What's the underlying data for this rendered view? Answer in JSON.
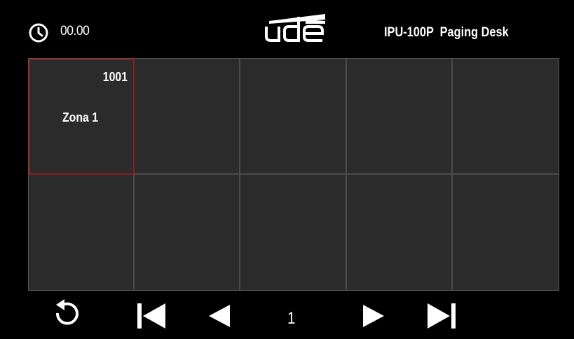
{
  "header": {
    "time": "00.00",
    "logo_text": "ude",
    "device_title": "IPU-100P  Paging Desk"
  },
  "grid": {
    "columns": 5,
    "rows": 2,
    "cells": [
      {
        "number": "1001",
        "name": "Zona 1",
        "selected": true
      },
      {
        "number": "",
        "name": "",
        "selected": false
      },
      {
        "number": "",
        "name": "",
        "selected": false
      },
      {
        "number": "",
        "name": "",
        "selected": false
      },
      {
        "number": "",
        "name": "",
        "selected": false
      },
      {
        "number": "",
        "name": "",
        "selected": false
      },
      {
        "number": "",
        "name": "",
        "selected": false
      },
      {
        "number": "",
        "name": "",
        "selected": false
      },
      {
        "number": "",
        "name": "",
        "selected": false
      },
      {
        "number": "",
        "name": "",
        "selected": false
      }
    ]
  },
  "nav": {
    "page_number": "1",
    "icons": [
      "back-icon",
      "first-page-icon",
      "previous-page-icon",
      "next-page-icon",
      "last-page-icon"
    ]
  },
  "colors": {
    "background": "#000000",
    "cell_background": "#2b2b2b",
    "cell_border": "#4b4b4b",
    "selected_border": "#8c1c22",
    "text": "#ffffff"
  }
}
